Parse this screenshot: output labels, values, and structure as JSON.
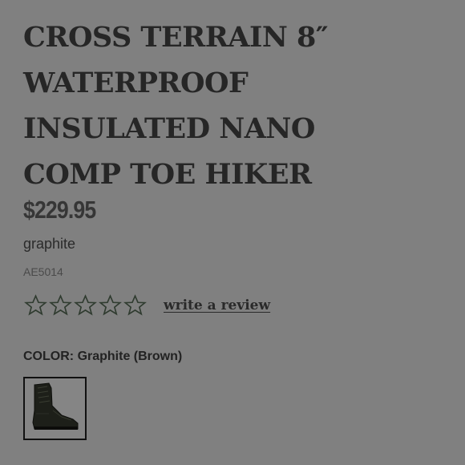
{
  "product": {
    "title_lines": [
      "CROSS TERRAIN 8″",
      "WATERPROOF",
      "INSULATED NANO",
      "COMP TOE HIKER"
    ],
    "price": "$229.95",
    "variant": "graphite",
    "sku": "AE5014"
  },
  "rating": {
    "stars_total": 5,
    "stars_filled": 0,
    "star_icon": "star-outline-icon",
    "star_color": "#2f3b2f",
    "review_link": "write a review"
  },
  "color": {
    "label": "COLOR:",
    "value": "Graphite (Brown)",
    "swatches": [
      {
        "name": "Graphite (Brown)",
        "icon": "boot-thumbnail",
        "selected": true
      }
    ]
  }
}
